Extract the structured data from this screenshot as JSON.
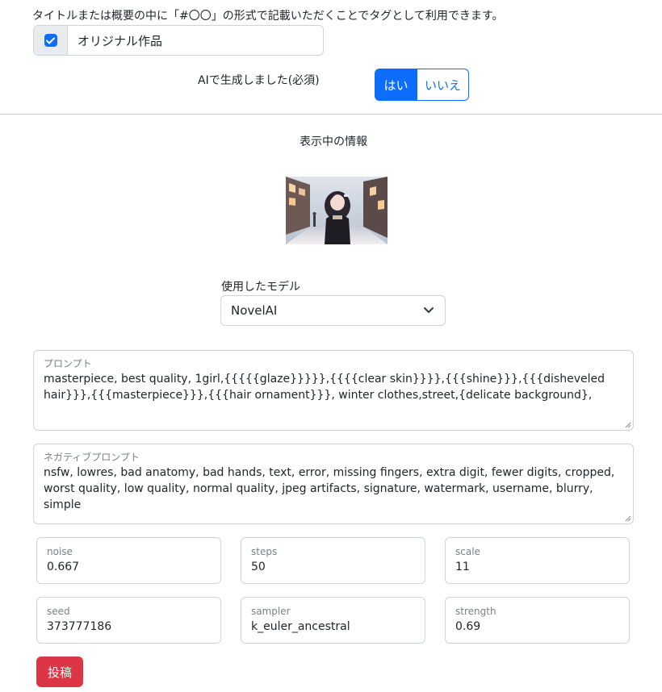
{
  "tag_hint": "タイトルまたは概要の中に「#〇〇」の形式で記載いただくことでタグとして利用できます。",
  "original_work": {
    "label": "オリジナル作品",
    "checked": true
  },
  "ai_generated": {
    "label": "AIで生成しました(必須)",
    "yes": "はい",
    "no": "いいえ",
    "selected": "はい"
  },
  "info_title": "表示中の情報",
  "thumbnail": {
    "description_icon": "image-thumbnail"
  },
  "model": {
    "label": "使用したモデル",
    "value": "NovelAI"
  },
  "prompt": {
    "label": "プロンプト",
    "value": "masterpiece, best quality, 1girl,{{{{{glaze}}}}},{{{{clear skin}}}},{{{shine}}},{{{disheveled hair}}},{{{masterpiece}}},{{{hair ornament}}}, winter clothes,street,{delicate background},"
  },
  "negative_prompt": {
    "label": "ネガティブプロンプト",
    "value": "nsfw, lowres, bad anatomy, bad hands, text, error, missing fingers, extra digit, fewer digits, cropped, worst quality, low quality, normal quality, jpeg artifacts, signature, watermark, username, blurry, simple"
  },
  "params": [
    {
      "label": "noise",
      "value": "0.667"
    },
    {
      "label": "steps",
      "value": "50"
    },
    {
      "label": "scale",
      "value": "11"
    },
    {
      "label": "seed",
      "value": "373777186"
    },
    {
      "label": "sampler",
      "value": "k_euler_ancestral"
    },
    {
      "label": "strength",
      "value": "0.69"
    }
  ],
  "submit_label": "投稿",
  "colors": {
    "primary": "#0d6efd",
    "danger": "#dc3545",
    "border": "#ced4da"
  }
}
